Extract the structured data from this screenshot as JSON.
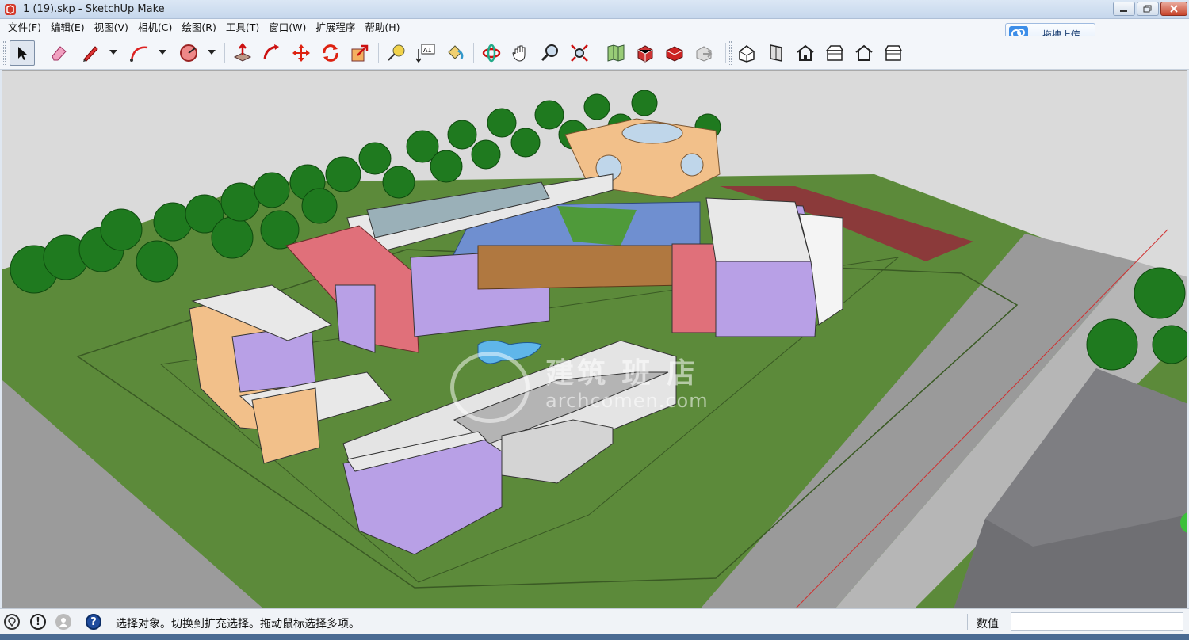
{
  "window": {
    "title": "1 (19).skp - SketchUp Make"
  },
  "menu": {
    "items": [
      {
        "label": "文件(F)"
      },
      {
        "label": "编辑(E)"
      },
      {
        "label": "视图(V)"
      },
      {
        "label": "相机(C)"
      },
      {
        "label": "绘图(R)"
      },
      {
        "label": "工具(T)"
      },
      {
        "label": "窗口(W)"
      },
      {
        "label": "扩展程序"
      },
      {
        "label": "帮助(H)"
      }
    ],
    "upload_button": "拖拽上传"
  },
  "toolbar": {
    "tools": [
      {
        "icon": "select-arrow-icon",
        "active": true
      },
      {
        "icon": "eraser-icon"
      },
      {
        "icon": "pencil-line-icon"
      },
      {
        "icon": "arc-icon"
      },
      {
        "icon": "circle-shape-icon"
      },
      {
        "icon": "push-pull-icon"
      },
      {
        "icon": "follow-me-icon"
      },
      {
        "icon": "move-icon"
      },
      {
        "icon": "rotate-icon"
      },
      {
        "icon": "scale-icon"
      },
      {
        "icon": "tape-measure-icon"
      },
      {
        "icon": "text-label-icon"
      },
      {
        "icon": "paint-bucket-icon"
      },
      {
        "icon": "orbit-icon"
      },
      {
        "icon": "pan-hand-icon"
      },
      {
        "icon": "zoom-icon"
      },
      {
        "icon": "zoom-extents-icon"
      },
      {
        "icon": "map-location-icon"
      },
      {
        "icon": "3d-warehouse-icon"
      },
      {
        "icon": "extension-warehouse-icon"
      },
      {
        "icon": "share-model-icon"
      },
      {
        "icon": "iso-view-icon"
      },
      {
        "icon": "top-view-icon"
      },
      {
        "icon": "front-view-icon"
      },
      {
        "icon": "right-view-icon"
      },
      {
        "icon": "back-view-icon"
      },
      {
        "icon": "left-view-icon"
      }
    ]
  },
  "viewport": {
    "watermark_cn": "建筑 班 店",
    "watermark_en": "archcomen.com",
    "colors": {
      "sky": "#dadada",
      "grass": "#5f8d3c",
      "road": "#9a9a9a",
      "tree": "#1f7a1f",
      "purple_wall": "#b8a0e6",
      "pink_wall": "#e0707a",
      "orange_wall": "#f2c08a"
    }
  },
  "status": {
    "message": "选择对象。切换到扩充选择。拖动鼠标选择多项。",
    "value_label": "数值",
    "value": ""
  }
}
